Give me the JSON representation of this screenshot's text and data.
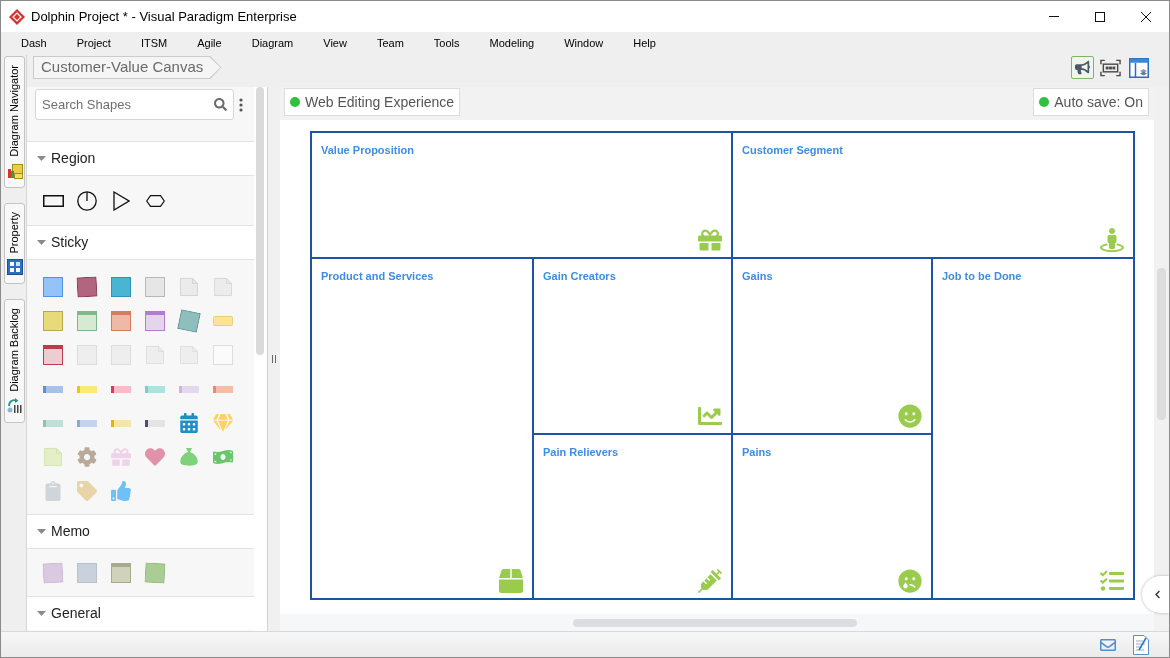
{
  "window": {
    "title": "Dolphin Project * - Visual Paradigm Enterprise"
  },
  "menu": [
    "Dash",
    "Project",
    "ITSM",
    "Agile",
    "Diagram",
    "View",
    "Team",
    "Tools",
    "Modeling",
    "Window",
    "Help"
  ],
  "side_tabs": [
    {
      "label": "Diagram Navigator"
    },
    {
      "label": "Property"
    },
    {
      "label": "Diagram Backlog"
    }
  ],
  "breadcrumb": "Customer-Value Canvas",
  "toolbar_buttons": [
    {
      "selected": true
    },
    {
      "selected": false
    },
    {
      "selected": false
    }
  ],
  "palette": {
    "search": {
      "placeholder": "Search Shapes"
    },
    "sections": [
      {
        "label": "Region",
        "expanded": true
      },
      {
        "label": "Sticky",
        "expanded": true
      },
      {
        "label": "Memo",
        "expanded": true
      },
      {
        "label": "General",
        "expanded": true
      }
    ]
  },
  "diagram_bar": {
    "web_editing": "Web Editing Experience",
    "auto_save": "Auto save: On"
  },
  "canvas": {
    "cells": [
      {
        "title": "Value Proposition"
      },
      {
        "title": "Customer Segment"
      },
      {
        "title": "Product and Services"
      },
      {
        "title": "Gain Creators"
      },
      {
        "title": "Gains"
      },
      {
        "title": "Job to be Done"
      },
      {
        "title": "Pain Relievers"
      },
      {
        "title": "Pains"
      }
    ]
  }
}
